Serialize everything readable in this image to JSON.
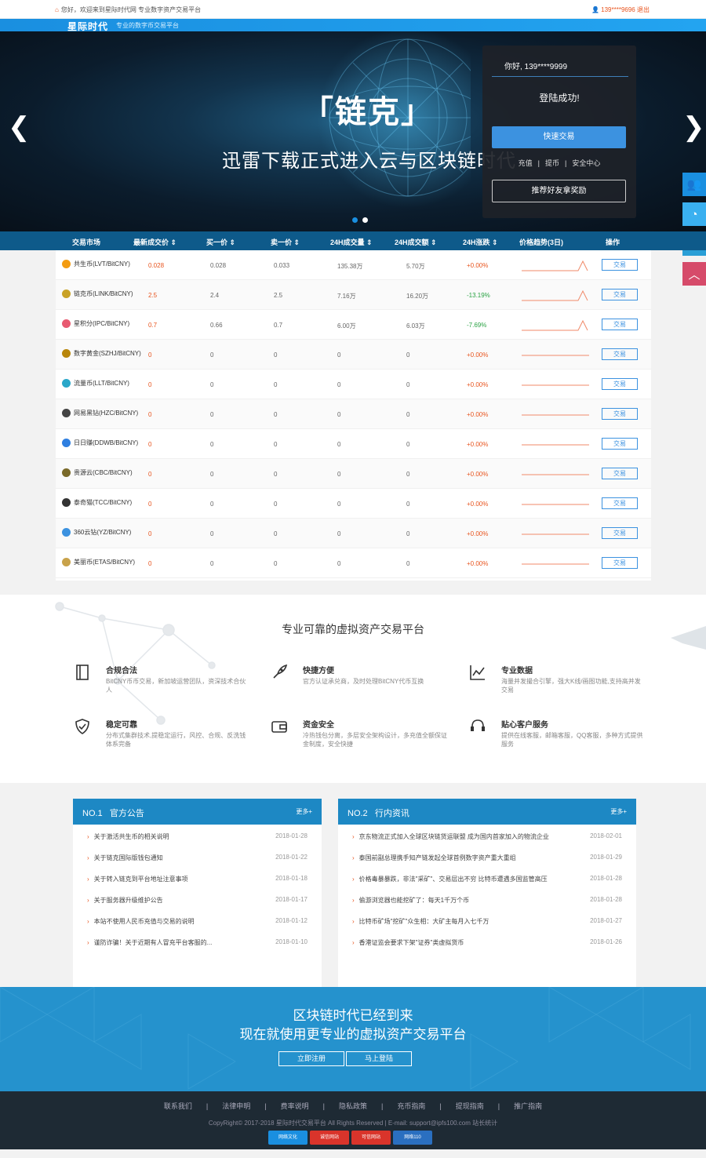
{
  "topbar": {
    "welcome": "您好，欢迎来到星际时代网 专业数字资产交易平台",
    "user": "139****9696",
    "logout": "退出"
  },
  "header": {
    "logo": "星际时代",
    "slogan": "专业的数字币交易平台"
  },
  "banner": {
    "title": "「链克」",
    "subtitle": "迅雷下载正式进入云与区块链时代"
  },
  "login": {
    "hello": "你好, 139****9999",
    "status": "登陆成功!",
    "trade_btn": "快速交易",
    "link1": "充值",
    "link2": "提币",
    "link3": "安全中心",
    "refer_btn": "推荐好友拿奖励"
  },
  "market": {
    "headers": [
      "交易市场",
      "最新成交价 ⇕",
      "买一价 ⇕",
      "卖一价 ⇕",
      "24H成交量 ⇕",
      "24H成交额 ⇕",
      "24H涨跌 ⇕",
      "价格趋势(3日)",
      "操作"
    ],
    "trade_label": "交易",
    "rows": [
      {
        "name": "共生币(LVT/BitCNY)",
        "icon_color": "#f39c12",
        "last": "0.028",
        "buy": "0.028",
        "sell": "0.033",
        "vol": "135.38万",
        "amt": "5.70万",
        "chg": "+0.00%",
        "dir": "red",
        "trend": "spike"
      },
      {
        "name": "链克币(LINK/BitCNY)",
        "icon_color": "#c9a227",
        "last": "2.5",
        "buy": "2.4",
        "sell": "2.5",
        "vol": "7.16万",
        "amt": "16.20万",
        "chg": "-13.19%",
        "dir": "grn",
        "trend": "spike"
      },
      {
        "name": "星积分(IPC/BitCNY)",
        "icon_color": "#e85a71",
        "last": "0.7",
        "buy": "0.66",
        "sell": "0.7",
        "vol": "6.00万",
        "amt": "6.03万",
        "chg": "-7.69%",
        "dir": "grn",
        "trend": "spike"
      },
      {
        "name": "数字黄金(SZHJ/BitCNY)",
        "icon_color": "#b8860b",
        "last": "0",
        "buy": "0",
        "sell": "0",
        "vol": "0",
        "amt": "0",
        "chg": "+0.00%",
        "dir": "red",
        "trend": "flat"
      },
      {
        "name": "流量币(LLT/BitCNY)",
        "icon_color": "#2aa7c9",
        "last": "0",
        "buy": "0",
        "sell": "0",
        "vol": "0",
        "amt": "0",
        "chg": "+0.00%",
        "dir": "red",
        "trend": "flat"
      },
      {
        "name": "网易黑钻(HZC/BitCNY)",
        "icon_color": "#444444",
        "last": "0",
        "buy": "0",
        "sell": "0",
        "vol": "0",
        "amt": "0",
        "chg": "+0.00%",
        "dir": "red",
        "trend": "flat"
      },
      {
        "name": "日日赚(DDWB/BitCNY)",
        "icon_color": "#2f7fe0",
        "last": "0",
        "buy": "0",
        "sell": "0",
        "vol": "0",
        "amt": "0",
        "chg": "+0.00%",
        "dir": "red",
        "trend": "flat"
      },
      {
        "name": "贵源云(CBC/BitCNY)",
        "icon_color": "#7a6a2a",
        "last": "0",
        "buy": "0",
        "sell": "0",
        "vol": "0",
        "amt": "0",
        "chg": "+0.00%",
        "dir": "red",
        "trend": "flat"
      },
      {
        "name": "泰奇猫(TCC/BitCNY)",
        "icon_color": "#333333",
        "last": "0",
        "buy": "0",
        "sell": "0",
        "vol": "0",
        "amt": "0",
        "chg": "+0.00%",
        "dir": "red",
        "trend": "flat"
      },
      {
        "name": "360云钻(YZ/BitCNY)",
        "icon_color": "#3c92e0",
        "last": "0",
        "buy": "0",
        "sell": "0",
        "vol": "0",
        "amt": "0",
        "chg": "+0.00%",
        "dir": "red",
        "trend": "flat"
      },
      {
        "name": "美丽币(ETAS/BitCNY)",
        "icon_color": "#c8a24a",
        "last": "0",
        "buy": "0",
        "sell": "0",
        "vol": "0",
        "amt": "0",
        "chg": "+0.00%",
        "dir": "red",
        "trend": "flat"
      }
    ]
  },
  "features": {
    "title": "专业可靠的虚拟资产交易平台",
    "items": [
      {
        "title": "合规合法",
        "desc": "BitCNY币币交易，新加坡运营团队，资深技术合伙人",
        "icon": "book-icon"
      },
      {
        "title": "快捷方便",
        "desc": "官方认证承兑商，及时处理BitCNY代币互换",
        "icon": "rocket-icon"
      },
      {
        "title": "专业数据",
        "desc": "海量并发撮合引擎，强大K线/画图功能,支持高并发交易",
        "icon": "chart-icon"
      },
      {
        "title": "稳定可靠",
        "desc": "分布式集群技术,提稳定运行，风控、合规、反洗钱体系完备",
        "icon": "shield-icon"
      },
      {
        "title": "资金安全",
        "desc": "冷热钱包分离，多层安全架构设计，多充值全额保证金制度，安全快捷",
        "icon": "wallet-icon"
      },
      {
        "title": "贴心客户服务",
        "desc": "提供在线客服，邮箱客服，QQ客服，多种方式提供服务",
        "icon": "headset-icon"
      }
    ]
  },
  "notice": {
    "no": "NO.1",
    "title": "官方公告",
    "more": "更多+",
    "items": [
      {
        "t": "关于激活共生币的相关说明",
        "d": "2018-01-28"
      },
      {
        "t": "关于链克国际版钱包通知",
        "d": "2018-01-22"
      },
      {
        "t": "关于转入链克到平台地址注意事项",
        "d": "2018-01-18"
      },
      {
        "t": "关于服务器升级维护公告",
        "d": "2018-01-17"
      },
      {
        "t": "本站不使用人民币充值与交易的说明",
        "d": "2018-01-12"
      },
      {
        "t": "谨防诈骗！关于近期有人冒充平台客服的...",
        "d": "2018-01-10"
      }
    ]
  },
  "industry": {
    "no": "NO.2",
    "title": "行内资讯",
    "more": "更多+",
    "items": [
      {
        "t": "京东物流正式加入全球区块链货运联盟 成为国内首家加入的物流企业",
        "d": "2018-02-01"
      },
      {
        "t": "泰国前副总理携手知产链发起全球首例数字资产重大重组",
        "d": "2018-01-29"
      },
      {
        "t": "价格毒暴暴跌，非法\"采矿\"、交易层出不穷 比特币遭遇多国监管高压",
        "d": "2018-01-28"
      },
      {
        "t": "偷游浏览器也能挖矿了：每天1千万个币",
        "d": "2018-01-28"
      },
      {
        "t": "比特币矿场\"挖矿\"众生相：大矿主每月入七千万",
        "d": "2018-01-27"
      },
      {
        "t": "香港证监会要求下架\"证券\"类虚拟货币",
        "d": "2018-01-26"
      }
    ]
  },
  "cta": {
    "line1": "区块链时代已经到来",
    "line2": "现在就使用更专业的虚拟资产交易平台",
    "register": "立即注册",
    "login": "马上登陆"
  },
  "footer": {
    "links": [
      "联系我们",
      "法律申明",
      "费率说明",
      "隐私政策",
      "充币指南",
      "提现指南",
      "推广指南"
    ],
    "sep": "|",
    "copy": "CopyRight© 2017-2018 星际时代交易平台 All Rights Reserved | E-mail: support@ipfs100.com 站长统计",
    "badges": [
      "网络文化",
      "诚信网站",
      "可信网站",
      "网络110"
    ]
  }
}
